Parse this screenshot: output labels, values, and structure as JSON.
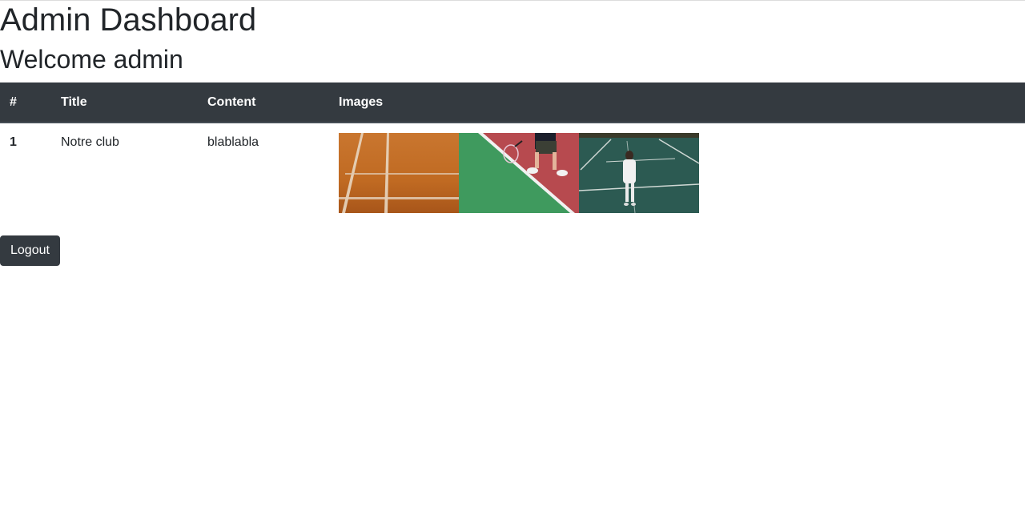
{
  "page": {
    "title": "Admin Dashboard",
    "welcome": "Welcome admin"
  },
  "table": {
    "headers": [
      "#",
      "Title",
      "Content",
      "Images"
    ],
    "rows": [
      {
        "num": "1",
        "title": "Notre club",
        "content": "blablabla",
        "images": [
          "clay-court-lines-photo",
          "tennis-player-court-photo",
          "woman-on-green-court-photo"
        ]
      }
    ]
  },
  "actions": {
    "logout_label": "Logout"
  }
}
